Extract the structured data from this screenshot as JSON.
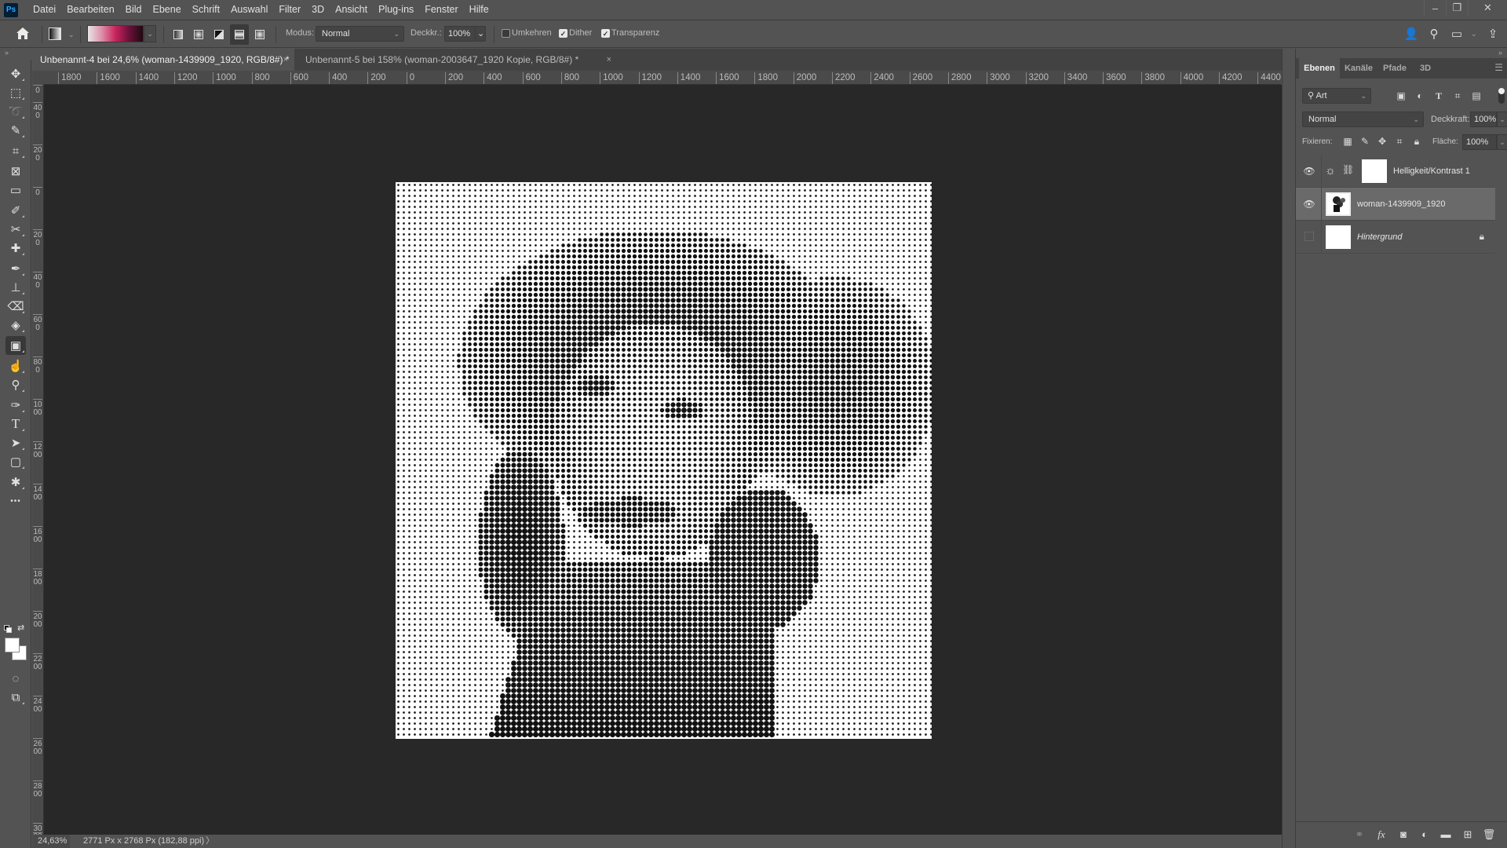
{
  "app": {
    "logo": "Ps"
  },
  "menu": [
    "Datei",
    "Bearbeiten",
    "Bild",
    "Ebene",
    "Schrift",
    "Auswahl",
    "Filter",
    "3D",
    "Ansicht",
    "Plug-ins",
    "Fenster",
    "Hilfe"
  ],
  "window_controls": {
    "minimize": "–",
    "restore": "❐",
    "close": "✕"
  },
  "options_bar": {
    "home_icon": "home-icon",
    "gradient_colors": [
      "#e8e4e6",
      "#dc8fa9",
      "#c9245e",
      "#6b1038",
      "#1f0a12"
    ],
    "gradient_types": [
      "linear",
      "radial",
      "angle",
      "reflected",
      "diamond"
    ],
    "active_gradient_type": "reflected",
    "mode_label": "Modus:",
    "mode_value": "Normal",
    "opacity_label": "Deckkr.:",
    "opacity_value": "100%",
    "reverse_label": "Umkehren",
    "reverse_checked": false,
    "dither_label": "Dither",
    "dither_checked": true,
    "transparency_label": "Transparenz",
    "transparency_checked": true
  },
  "tabs": [
    {
      "title": "Unbenannt-4 bei 24,6% (woman-1439909_1920, RGB/8#) *",
      "active": true,
      "close": "×"
    },
    {
      "title": "Unbenannt-5 bei 158% (woman-2003647_1920 Kopie, RGB/8#) *",
      "active": false,
      "close": "×"
    }
  ],
  "ruler_top": [
    "1800",
    "1600",
    "1400",
    "1200",
    "1000",
    "800",
    "600",
    "400",
    "200",
    "0",
    "200",
    "400",
    "600",
    "800",
    "1000",
    "1200",
    "1400",
    "1600",
    "1800",
    "2000",
    "2200",
    "2400",
    "2600",
    "2800",
    "3000",
    "3200",
    "3400",
    "3600",
    "3800",
    "4000",
    "4200",
    "4400"
  ],
  "ruler_left": [
    "0",
    "400",
    "200",
    "0",
    "200",
    "400",
    "600",
    "800",
    "1000",
    "1200",
    "1400",
    "1600",
    "1800",
    "2000",
    "2200",
    "2400",
    "2600",
    "2800",
    "3000",
    "3"
  ],
  "tools": [
    {
      "name": "move-tool",
      "glyph": "✥"
    },
    {
      "name": "rectangular-marquee-tool",
      "glyph": "⬚"
    },
    {
      "name": "lasso-tool",
      "glyph": "➰"
    },
    {
      "name": "quick-selection-tool",
      "glyph": "✎"
    },
    {
      "name": "crop-tool",
      "glyph": "⌗"
    },
    {
      "name": "frame-tool",
      "glyph": "⊠"
    },
    {
      "name": "ruler-tool",
      "glyph": "▭"
    },
    {
      "name": "eyedropper-tool",
      "glyph": "✐"
    },
    {
      "name": "content-aware-move-tool",
      "glyph": "✂"
    },
    {
      "name": "healing-brush-tool",
      "glyph": "✚"
    },
    {
      "name": "brush-tool",
      "glyph": "✒"
    },
    {
      "name": "clone-stamp-tool",
      "glyph": "⊥"
    },
    {
      "name": "eraser-tool",
      "glyph": "⌫"
    },
    {
      "name": "paint-bucket-tool",
      "glyph": "◈"
    },
    {
      "name": "gradient-tool",
      "glyph": "▣"
    },
    {
      "name": "smudge-tool",
      "glyph": "☝"
    },
    {
      "name": "dodge-tool",
      "glyph": "⚲"
    },
    {
      "name": "pen-tool",
      "glyph": "✑"
    },
    {
      "name": "type-tool",
      "glyph": "T"
    },
    {
      "name": "path-selection-tool",
      "glyph": "➤"
    },
    {
      "name": "rectangle-tool",
      "glyph": "▢"
    },
    {
      "name": "custom-shape-tool",
      "glyph": "✱"
    },
    {
      "name": "edit-toolbar",
      "glyph": "•••"
    }
  ],
  "active_tool": "gradient-tool",
  "colors": {
    "foreground": "#ffffff",
    "background": "#ffffff"
  },
  "extra_tools": [
    {
      "name": "quick-mask-mode",
      "glyph": "◌"
    },
    {
      "name": "screen-mode",
      "glyph": "⧉"
    }
  ],
  "status": {
    "zoom": "24,63%",
    "doc_info": "2771 Px x 2768 Px (182,88 ppi)",
    "arrow": "〉"
  },
  "layers_panel": {
    "tabs": [
      "Ebenen",
      "Kanäle",
      "Pfade",
      "3D"
    ],
    "active_tab": "Ebenen",
    "filter_value": "Art",
    "blend_mode": "Normal",
    "opacity_label": "Deckkraft:",
    "opacity_value": "100%",
    "lock_label": "Fixieren:",
    "fill_label": "Fläche:",
    "fill_value": "100%",
    "layers": [
      {
        "name": "Helligkeit/Kontrast 1",
        "visible": true,
        "type": "adjustment",
        "selected": false,
        "locked": false,
        "italic": false
      },
      {
        "name": "woman-1439909_1920",
        "visible": true,
        "type": "pixel",
        "selected": true,
        "locked": false,
        "italic": false
      },
      {
        "name": "Hintergrund",
        "visible": false,
        "type": "background",
        "selected": false,
        "locked": true,
        "italic": true
      }
    ],
    "footer_icons": [
      "link-layers-icon",
      "fx-icon",
      "add-mask-icon",
      "adjustment-layer-icon",
      "group-icon",
      "new-layer-icon",
      "delete-icon"
    ]
  }
}
